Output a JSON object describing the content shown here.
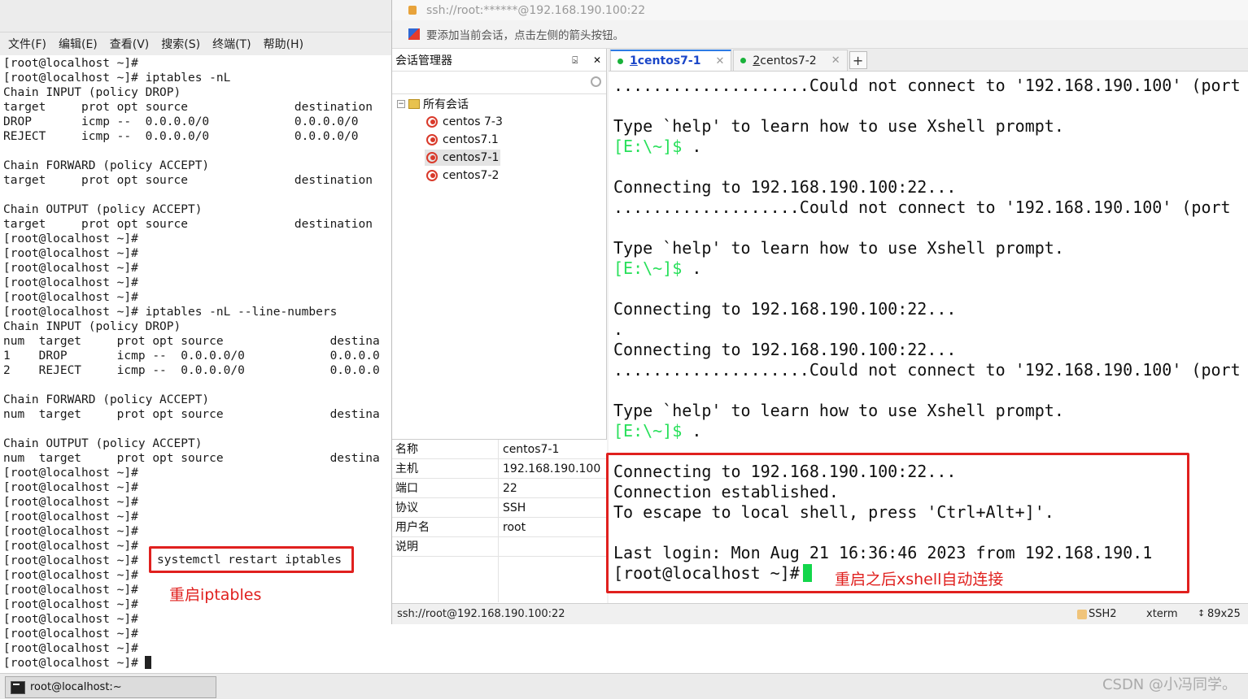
{
  "left_terminal": {
    "menu": [
      "文件(F)",
      "编辑(E)",
      "查看(V)",
      "搜索(S)",
      "终端(T)",
      "帮助(H)"
    ],
    "lines": [
      "[root@localhost ~]#",
      "[root@localhost ~]# iptables -nL",
      "Chain INPUT (policy DROP)",
      "target     prot opt source               destination",
      "DROP       icmp --  0.0.0.0/0            0.0.0.0/0",
      "REJECT     icmp --  0.0.0.0/0            0.0.0.0/0",
      "",
      "Chain FORWARD (policy ACCEPT)",
      "target     prot opt source               destination",
      "",
      "Chain OUTPUT (policy ACCEPT)",
      "target     prot opt source               destination",
      "[root@localhost ~]#",
      "[root@localhost ~]#",
      "[root@localhost ~]#",
      "[root@localhost ~]#",
      "[root@localhost ~]#",
      "[root@localhost ~]# iptables -nL --line-numbers",
      "Chain INPUT (policy DROP)",
      "num  target     prot opt source               destina",
      "1    DROP       icmp --  0.0.0.0/0            0.0.0.0",
      "2    REJECT     icmp --  0.0.0.0/0            0.0.0.0",
      "",
      "Chain FORWARD (policy ACCEPT)",
      "num  target     prot opt source               destina",
      "",
      "Chain OUTPUT (policy ACCEPT)",
      "num  target     prot opt source               destina",
      "[root@localhost ~]#",
      "[root@localhost ~]#",
      "[root@localhost ~]#",
      "[root@localhost ~]#",
      "[root@localhost ~]#",
      "[root@localhost ~]#",
      "[root@localhost ~]#",
      "[root@localhost ~]#",
      "[root@localhost ~]#",
      "[root@localhost ~]#",
      "[root@localhost ~]#",
      "[root@localhost ~]#",
      "[root@localhost ~]#",
      "[root@localhost ~]#"
    ],
    "highlight_cmd": "systemctl restart iptables",
    "annotation": "重启iptables",
    "taskbar_item": "root@localhost:~"
  },
  "xshell": {
    "title": "ssh://root:******@192.168.190.100:22",
    "hint": "要添加当前会话，点击左侧的箭头按钮。",
    "session_manager": {
      "title": "会话管理器",
      "pin": "⍄",
      "close": "✕",
      "root": "所有会话",
      "sessions": [
        "centos 7-3",
        "centos7.1",
        "centos7-1",
        "centos7-2"
      ],
      "selected": "centos7-1",
      "props": [
        {
          "k": "名称",
          "v": "centos7-1"
        },
        {
          "k": "主机",
          "v": "192.168.190.100"
        },
        {
          "k": "端口",
          "v": "22"
        },
        {
          "k": "协议",
          "v": "SSH"
        },
        {
          "k": "用户名",
          "v": "root"
        },
        {
          "k": "说明",
          "v": ""
        }
      ]
    },
    "tabs": [
      {
        "num": "1",
        "label": " centos7-1",
        "active": true
      },
      {
        "num": "2",
        "label": " centos7-2",
        "active": false
      }
    ],
    "tab_add": "+",
    "tab_close": "✕",
    "terminal_lines": [
      {
        "t": "....................Could not connect to '192.168.190.100' (port"
      },
      {
        "t": ""
      },
      {
        "t": "Type `help' to learn how to use Xshell prompt."
      },
      {
        "t": "[E:\\~]$ .",
        "prompt": true
      },
      {
        "t": ""
      },
      {
        "t": "Connecting to 192.168.190.100:22..."
      },
      {
        "t": "...................Could not connect to '192.168.190.100' (port"
      },
      {
        "t": ""
      },
      {
        "t": "Type `help' to learn how to use Xshell prompt."
      },
      {
        "t": "[E:\\~]$ .",
        "prompt": true
      },
      {
        "t": ""
      },
      {
        "t": "Connecting to 192.168.190.100:22..."
      },
      {
        "t": "."
      },
      {
        "t": "Connecting to 192.168.190.100:22..."
      },
      {
        "t": "....................Could not connect to '192.168.190.100' (port"
      },
      {
        "t": ""
      },
      {
        "t": "Type `help' to learn how to use Xshell prompt."
      },
      {
        "t": "[E:\\~]$ .",
        "prompt": true
      },
      {
        "t": ""
      },
      {
        "t": "Connecting to 192.168.190.100:22..."
      },
      {
        "t": "Connection established."
      },
      {
        "t": "To escape to local shell, press 'Ctrl+Alt+]'."
      },
      {
        "t": ""
      },
      {
        "t": "Last login: Mon Aug 21 16:36:46 2023 from 192.168.190.1"
      },
      {
        "t": "[root@localhost ~]#",
        "cursor": true
      }
    ],
    "annotation": "重启之后xshell自动连接",
    "status": {
      "path": "ssh://root@192.168.190.100:22",
      "protocol": "SSH2",
      "term": "xterm",
      "size": "89x25"
    }
  },
  "watermark": "CSDN @小冯同学。",
  "colors": {
    "annotation_red": "#e0201e",
    "prompt_green": "#28e05a",
    "cursor_green": "#13d64b"
  }
}
